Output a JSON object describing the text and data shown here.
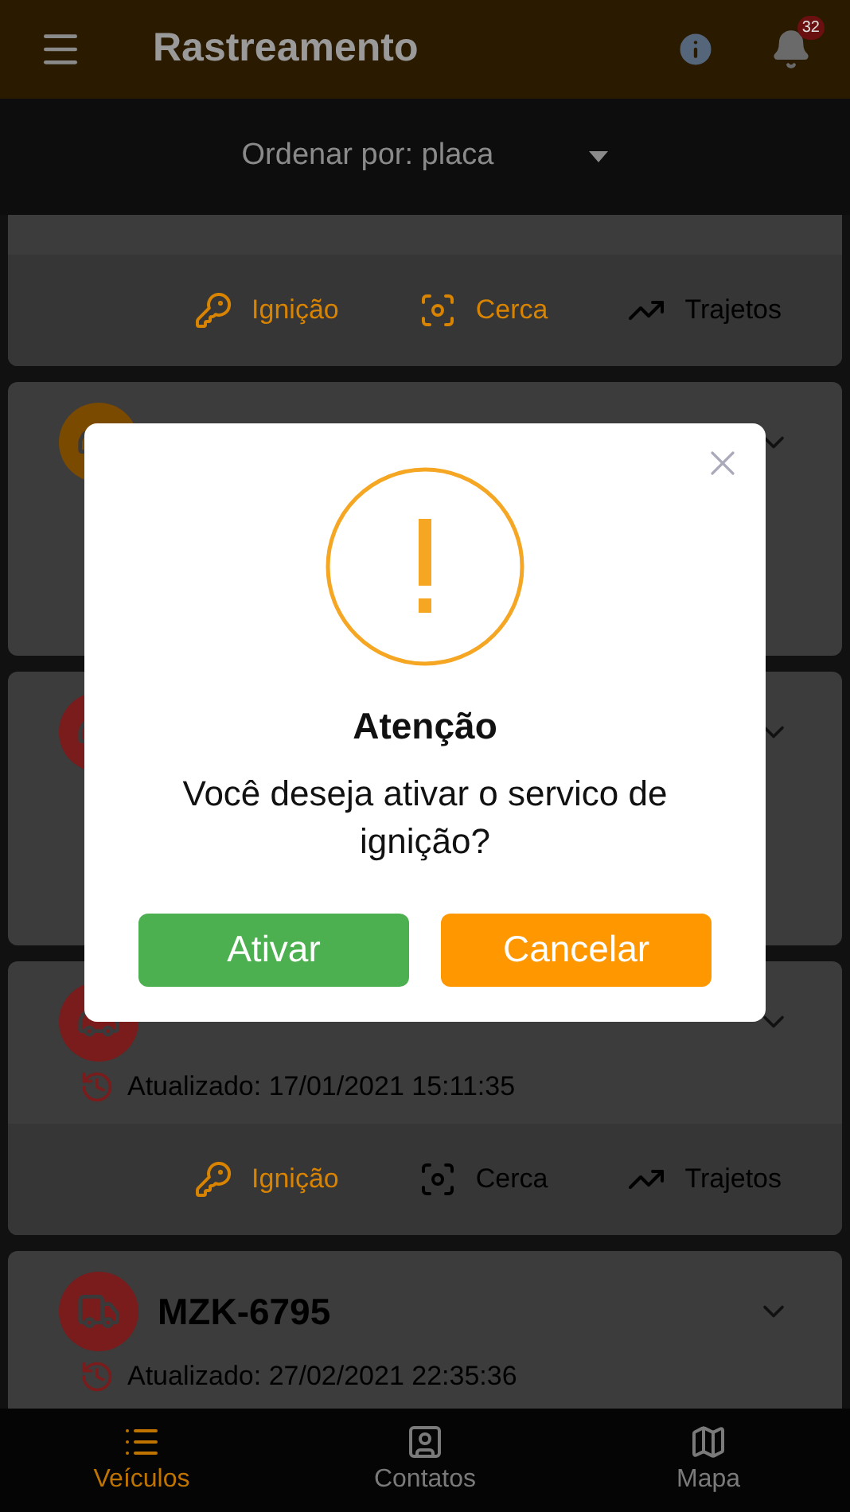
{
  "header": {
    "title": "Rastreamento",
    "badge": "32"
  },
  "sort": {
    "label": "Ordenar por: placa"
  },
  "vehicles": [
    {
      "actions": [
        {
          "kind": "ignition",
          "label": "Ignição",
          "active": true
        },
        {
          "kind": "fence",
          "label": "Cerca",
          "active": true
        },
        {
          "kind": "routes",
          "label": "Trajetos",
          "active": false
        }
      ]
    },
    {
      "kind": "car",
      "color": "#7a4a00"
    },
    {
      "kind": "car",
      "color": "#7a1c1c"
    },
    {
      "kind": "car",
      "color": "#7a1c1c",
      "updated": "Atualizado: 17/01/2021 15:11:35",
      "actions": [
        {
          "kind": "ignition",
          "label": "Ignição",
          "active": true
        },
        {
          "kind": "fence",
          "label": "Cerca",
          "active": false
        },
        {
          "kind": "routes",
          "label": "Trajetos",
          "active": false
        }
      ]
    },
    {
      "kind": "truck",
      "color": "#7a1c1c",
      "plate": "MZK-6795",
      "updated": "Atualizado: 27/02/2021 22:35:36"
    }
  ],
  "dialog": {
    "title": "Atenção",
    "message": "Você deseja ativar o servico de ignição?",
    "buttons": [
      {
        "kind": "confirm",
        "label": "Ativar"
      },
      {
        "kind": "cancel",
        "label": "Cancelar"
      }
    ]
  },
  "nav": [
    {
      "label": "Veículos",
      "selected": true
    },
    {
      "label": "Contatos",
      "selected": false
    },
    {
      "label": "Mapa",
      "selected": false
    }
  ]
}
